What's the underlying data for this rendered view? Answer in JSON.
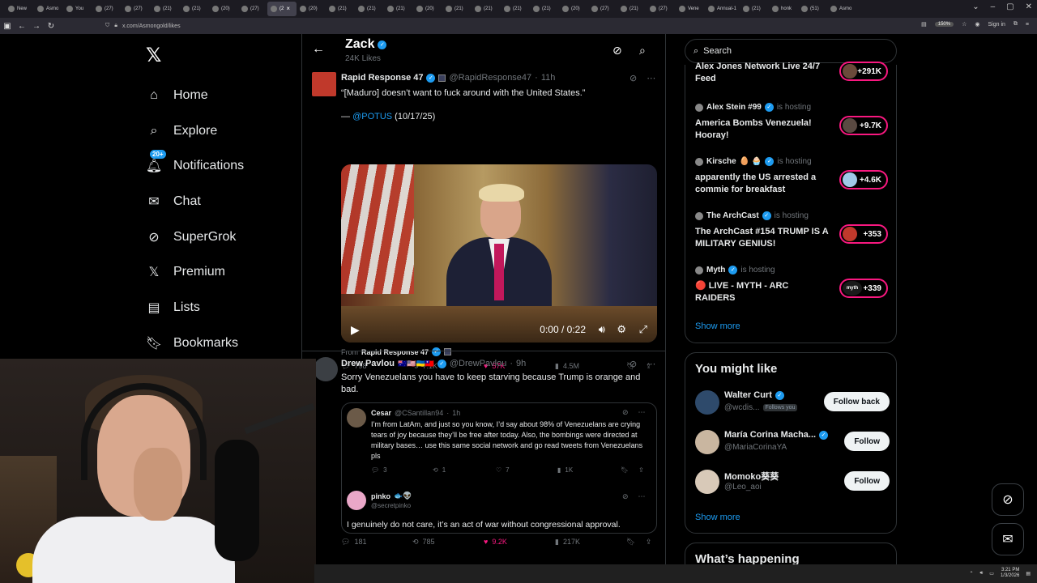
{
  "browser": {
    "tabs": [
      {
        "label": "New"
      },
      {
        "label": "Asmo"
      },
      {
        "label": "You"
      },
      {
        "label": "(27)"
      },
      {
        "label": "(27)"
      },
      {
        "label": "(21)"
      },
      {
        "label": "(21)"
      },
      {
        "label": "(20)"
      },
      {
        "label": "(27)"
      },
      {
        "label": "(2",
        "active": true
      },
      {
        "label": "(20)"
      },
      {
        "label": "(21)"
      },
      {
        "label": "(21)"
      },
      {
        "label": "(21)"
      },
      {
        "label": "(20)"
      },
      {
        "label": "(21)"
      },
      {
        "label": "(21)"
      },
      {
        "label": "(21)"
      },
      {
        "label": "(21)"
      },
      {
        "label": "(20)"
      },
      {
        "label": "(27)"
      },
      {
        "label": "(21)"
      },
      {
        "label": "(27)"
      },
      {
        "label": "Vene"
      },
      {
        "label": "Annual-1"
      },
      {
        "label": "(21)"
      },
      {
        "label": "honk"
      },
      {
        "label": "(51)"
      },
      {
        "label": "Asmo"
      }
    ],
    "url": "x.com/Asmongold/likes",
    "zoom": "150%",
    "sign_in": "Sign in"
  },
  "sidebar": {
    "items": [
      {
        "label": "Home",
        "icon": "home-icon"
      },
      {
        "label": "Explore",
        "icon": "search-icon"
      },
      {
        "label": "Notifications",
        "icon": "bell-icon",
        "badge": "20+"
      },
      {
        "label": "Chat",
        "icon": "mail-icon"
      },
      {
        "label": "SuperGrok",
        "icon": "grok-icon"
      },
      {
        "label": "Premium",
        "icon": "x-icon"
      },
      {
        "label": "Lists",
        "icon": "list-icon"
      },
      {
        "label": "Bookmarks",
        "icon": "bookmark-icon"
      }
    ]
  },
  "header": {
    "name": "Zack",
    "likes": "24K Likes"
  },
  "tweet1": {
    "name": "Rapid Response 47",
    "handle": "@RapidResponse47",
    "time": "11h",
    "text1": "“[Maduro] doesn’t want to fuck around with the United States.”",
    "dash": "— ",
    "mention": "@POTUS",
    "date": " (10/17/25)",
    "video_time": "0:00 / 0:22",
    "from_prefix": "From",
    "from_name": "Rapid Response 47",
    "replies": "798",
    "reposts": "7.1K",
    "likes": "57K",
    "views": "4.5M"
  },
  "tweet2": {
    "name": "Drew Pavlou",
    "flags": "🇦🇺🇺🇸🇺🇦🇹🇼",
    "handle": "@DrewPavlou",
    "time": "9h",
    "text": "Sorry Venezuelans you have to keep starving because Trump is orange and bad.",
    "quote": {
      "name": "Cesar",
      "handle": "@CSantillan94",
      "time": "1h",
      "text": "I’m from LatAm, and just so you know, I’d say about 98% of Venezuelans are crying tears of joy because they’ll be free after today. Also, the bombings were directed at military bases… use this same social network and go read tweets from Venezuelans pls",
      "replies": "3",
      "reposts": "1",
      "likes": "7",
      "views": "1K"
    },
    "reply": {
      "name": "pinko",
      "emoji": "🐟👽",
      "handle": "@secretpinko",
      "text": "I genuinely do not care, it’s an act of war without congressional approval."
    },
    "replies": "181",
    "reposts": "785",
    "likes": "9.2K",
    "views": "217K"
  },
  "right": {
    "search_placeholder": "Search",
    "spaces": [
      {
        "title": "Alex Jones Network Live 24/7 Feed",
        "listeners": "+291K"
      },
      {
        "host": "Alex Stein #99",
        "hosting": "is hosting",
        "title": "America Bombs Venezuela! Hooray!",
        "listeners": "+9.7K"
      },
      {
        "host": "Kirsche",
        "emoji": "🥚 🧁",
        "hosting": "is hosting",
        "title": "apparently the US arrested a commie for breakfast",
        "listeners": "+4.6K"
      },
      {
        "host": "The ArchCast",
        "hosting": "is hosting",
        "title": "The ArchCast #154 TRUMP IS A MILITARY GENIUS!",
        "listeners": "+353"
      },
      {
        "host": "Myth",
        "hosting": "is hosting",
        "title": "🔴 LIVE - MYTH - ARC RAIDERS",
        "listeners": "+339",
        "pill_label": "myth"
      }
    ],
    "show_more": "Show more",
    "you_might_like": "You might like",
    "users": [
      {
        "name": "Walter Curt",
        "handle": "@wcdis...",
        "follows_you": "Follows you",
        "button": "Follow back"
      },
      {
        "name": "María Corina Macha...",
        "handle": "@MariaCorinaYA",
        "button": "Follow"
      },
      {
        "name": "Momoko葵葵",
        "handle": "@Leo_aoi",
        "button": "Follow"
      }
    ],
    "show_more2": "Show more",
    "whats_happening": "What’s happening"
  },
  "taskbar": {
    "time": "3:21 PM",
    "date": "1/3/2026"
  }
}
